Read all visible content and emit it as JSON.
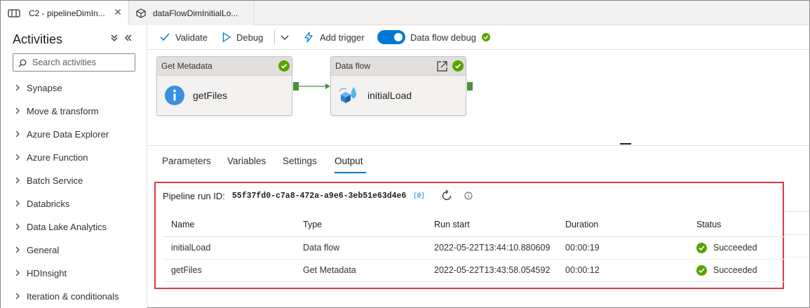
{
  "tabs": [
    {
      "label": "C2 - pipelineDimIn...",
      "icon": "pipeline-icon",
      "close": "✕"
    },
    {
      "label": "dataFlowDimInitialLo...",
      "icon": "dataflow-icon"
    }
  ],
  "sidebar": {
    "title": "Activities",
    "collapse_icon": "double-chevron-down-icon",
    "hide_icon": "double-chevron-left-icon",
    "search_placeholder": "Search activities",
    "categories": [
      "Synapse",
      "Move & transform",
      "Azure Data Explorer",
      "Azure Function",
      "Batch Service",
      "Databricks",
      "Data Lake Analytics",
      "General",
      "HDInsight",
      "Iteration & conditionals"
    ]
  },
  "toolbar": {
    "validate": "Validate",
    "debug": "Debug",
    "add_trigger": "Add trigger",
    "debug_toggle": "Data flow debug",
    "debug_toggle_on": true
  },
  "canvas": {
    "nodes": [
      {
        "type_label": "Get Metadata",
        "name": "getFiles",
        "icon": "info-icon",
        "status": "succeeded"
      },
      {
        "type_label": "Data flow",
        "name": "initialLoad",
        "icon": "dataflow-icon",
        "status": "succeeded"
      }
    ]
  },
  "panel": {
    "tabs": [
      "Parameters",
      "Variables",
      "Settings",
      "Output"
    ],
    "active_tab": "Output"
  },
  "output": {
    "run_id_label": "Pipeline run ID:",
    "run_id": "55f37fd0-c7a8-472a-a9e6-3eb51e63d4e6",
    "copy_icon_text": "[@]",
    "columns": [
      "Name",
      "Type",
      "Run start",
      "Duration",
      "Status"
    ],
    "rows": [
      {
        "name": "initialLoad",
        "type": "Data flow",
        "run_start": "2022-05-22T13:44:10.880609",
        "duration": "00:00:19",
        "status": "Succeeded"
      },
      {
        "name": "getFiles",
        "type": "Get Metadata",
        "run_start": "2022-05-22T13:43:58.054592",
        "duration": "00:00:12",
        "status": "Succeeded"
      }
    ]
  },
  "colors": {
    "accent": "#0078d4",
    "success": "#57a300",
    "highlight_border": "#e0393e"
  }
}
